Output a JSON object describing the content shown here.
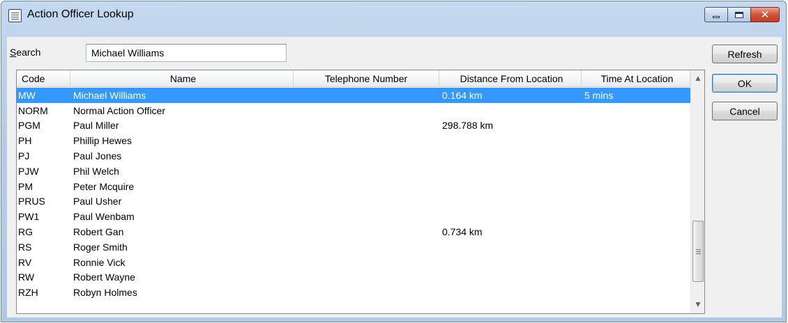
{
  "window": {
    "title": "Action Officer Lookup",
    "icons": {
      "app": "list-window-icon",
      "minimize": "minimize-icon",
      "maximize": "maximize-icon",
      "close": "close-icon"
    },
    "close_glyph": "✕"
  },
  "search": {
    "label_accel": "S",
    "label_rest": "earch",
    "value": "Michael Williams",
    "placeholder": ""
  },
  "buttons": {
    "refresh": "Refresh",
    "ok": "OK",
    "cancel": "Cancel"
  },
  "table": {
    "columns": [
      "Code",
      "Name",
      "Telephone Number",
      "Distance From Location",
      "Time At Location"
    ],
    "selected_row": 0,
    "rows": [
      {
        "code": "MW",
        "name": "Michael Williams",
        "telephone": "",
        "distance": "0.164  km",
        "time": "5 mins"
      },
      {
        "code": "NORM",
        "name": "Normal Action Officer",
        "telephone": "",
        "distance": "",
        "time": ""
      },
      {
        "code": "PGM",
        "name": "Paul Miller",
        "telephone": "",
        "distance": "298.788  km",
        "time": ""
      },
      {
        "code": "PH",
        "name": "Phillip Hewes",
        "telephone": "",
        "distance": "",
        "time": ""
      },
      {
        "code": "PJ",
        "name": "Paul Jones",
        "telephone": "",
        "distance": "",
        "time": ""
      },
      {
        "code": "PJW",
        "name": "Phil Welch",
        "telephone": "",
        "distance": "",
        "time": ""
      },
      {
        "code": "PM",
        "name": "Peter Mcquire",
        "telephone": "",
        "distance": "",
        "time": ""
      },
      {
        "code": "PRUS",
        "name": "Paul Usher",
        "telephone": "",
        "distance": "",
        "time": ""
      },
      {
        "code": "PW1",
        "name": "Paul Wenbam",
        "telephone": "",
        "distance": "",
        "time": ""
      },
      {
        "code": "RG",
        "name": "Robert Gan",
        "telephone": "",
        "distance": "0.734  km",
        "time": ""
      },
      {
        "code": "RS",
        "name": "Roger Smith",
        "telephone": "",
        "distance": "",
        "time": ""
      },
      {
        "code": "RV",
        "name": "Ronnie Vick",
        "telephone": "",
        "distance": "",
        "time": ""
      },
      {
        "code": "RW",
        "name": "Robert Wayne",
        "telephone": "",
        "distance": "",
        "time": ""
      },
      {
        "code": "RZH",
        "name": "Robyn Holmes",
        "telephone": "",
        "distance": "",
        "time": ""
      }
    ]
  },
  "scrollbar": {
    "up_glyph": "▲",
    "down_glyph": "▼",
    "icons": {
      "up": "scroll-up-arrow-icon",
      "down": "scroll-down-arrow-icon",
      "grip": "scroll-grip-icon"
    }
  },
  "colors": {
    "selection": "#3399ff",
    "titlebar": "#b9cfe7",
    "close_button": "#c94a30"
  }
}
